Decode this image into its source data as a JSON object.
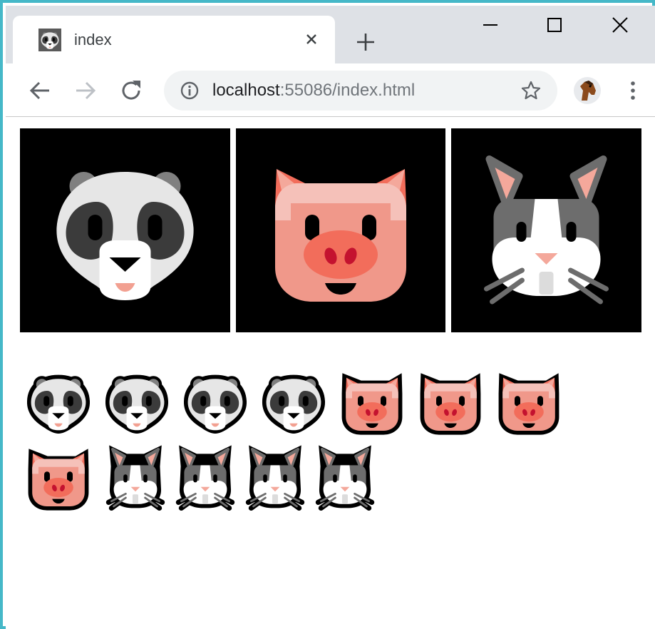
{
  "browser": {
    "tab": {
      "title": "index",
      "favicon": "panda-face-icon"
    },
    "address": {
      "host": "localhost",
      "rest": ":55086/index.html"
    },
    "icons": {
      "back": "arrow-left-icon",
      "forward": "arrow-right-icon",
      "reload": "reload-icon",
      "site_info": "info-icon",
      "bookmark": "star-icon",
      "profile": "horse-avatar-icon",
      "menu": "kebab-menu-icon"
    },
    "window_controls": [
      "minimize-icon",
      "maximize-icon",
      "close-icon"
    ]
  },
  "page": {
    "featured": [
      "panda",
      "pig",
      "rabbit"
    ],
    "small_rows": [
      [
        "panda",
        "panda",
        "panda",
        "panda",
        "pig",
        "pig",
        "pig"
      ],
      [
        "pig",
        "rabbit",
        "rabbit",
        "rabbit",
        "rabbit"
      ]
    ]
  },
  "colors": {
    "frame": "#45b8c8",
    "tabstrip": "#dee1e6",
    "tile_bg": "#000000"
  }
}
